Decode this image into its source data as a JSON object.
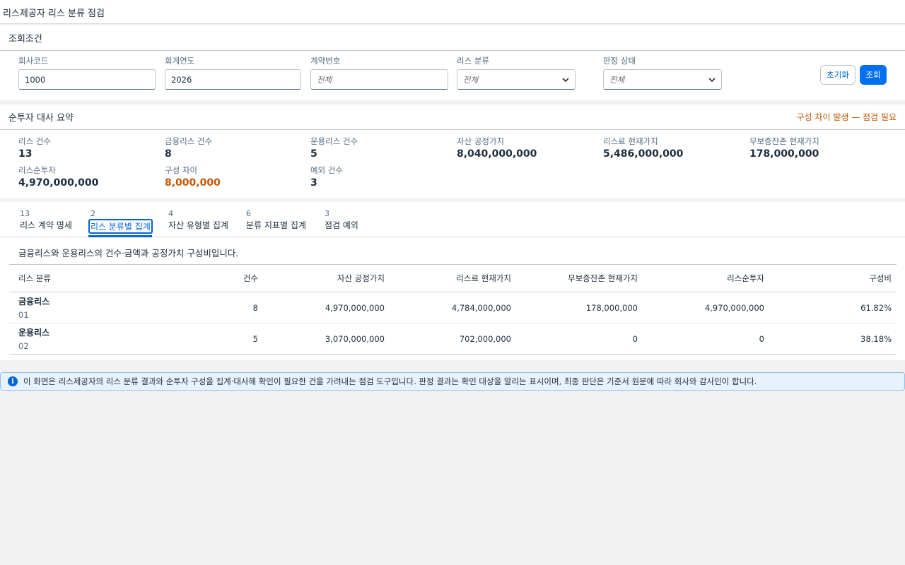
{
  "page": {
    "title": "리스제공자 리스 분류 점검"
  },
  "filter": {
    "title": "조회조건",
    "fields": [
      {
        "label": "회사코드",
        "value": "1000"
      },
      {
        "label": "회계연도",
        "value": "2026"
      },
      {
        "label": "계약번호",
        "placeholder": "전체"
      },
      {
        "label": "리스 분류",
        "selected": "전체"
      },
      {
        "label": "판정 상태",
        "selected": "전체"
      }
    ],
    "reset_label": "초기화",
    "search_label": "조회"
  },
  "summary": {
    "title": "순투자 대사 요약",
    "warning": "구성 차이 발생 — 점검 필요",
    "kpis": [
      {
        "label": "리스 건수",
        "value": "13"
      },
      {
        "label": "금융리스 건수",
        "value": "8"
      },
      {
        "label": "운용리스 건수",
        "value": "5"
      },
      {
        "label": "자산 공정가치",
        "value": "8,040,000,000"
      },
      {
        "label": "리스료 현재가치",
        "value": "5,486,000,000"
      },
      {
        "label": "무보증잔존 현재가치",
        "value": "178,000,000"
      },
      {
        "label": "리스순투자",
        "value": "4,970,000,000"
      },
      {
        "label": "구성 차이",
        "value": "8,000,000"
      },
      {
        "label": "예외 건수",
        "value": "3"
      }
    ]
  },
  "tabs": [
    {
      "count": "13",
      "label": "리스 계약 명세"
    },
    {
      "count": "2",
      "label": "리스 분류별 집계"
    },
    {
      "count": "4",
      "label": "자산 유형별 집계"
    },
    {
      "count": "6",
      "label": "분류 지표별 집계"
    },
    {
      "count": "3",
      "label": "점검 예외"
    }
  ],
  "content": {
    "description": "금융리스와 운용리스의 건수·금액과 공정가치 구성비입니다.",
    "columns": [
      "리스 분류",
      "건수",
      "자산 공정가치",
      "리스료 현재가치",
      "무보증잔존 현재가치",
      "리스순투자",
      "구성비"
    ],
    "rows": [
      {
        "name": "금융리스",
        "code": "01",
        "count": "8",
        "fair_value": "4,970,000,000",
        "pv_payments": "4,784,000,000",
        "pv_residual": "178,000,000",
        "net_investment": "4,970,000,000",
        "ratio": "61.82%"
      },
      {
        "name": "운용리스",
        "code": "02",
        "count": "5",
        "fair_value": "3,070,000,000",
        "pv_payments": "702,000,000",
        "pv_residual": "0",
        "net_investment": "0",
        "ratio": "38.18%"
      }
    ]
  },
  "info": {
    "icon": "info-icon",
    "text": "이 화면은 리스제공자의 리스 분류 결과와 순투자 구성을 집계·대사해 확인이 필요한 건을 가려내는 점검 도구입니다. 판정 결과는 확인 대상을 알리는 표시이며, 최종 판단은 기준서 원문에 따라 회사와 감사인이 합니다."
  },
  "colors": {
    "accent": "#0070f2",
    "warning": "#c35500",
    "info_bg": "#e7f2fc"
  }
}
